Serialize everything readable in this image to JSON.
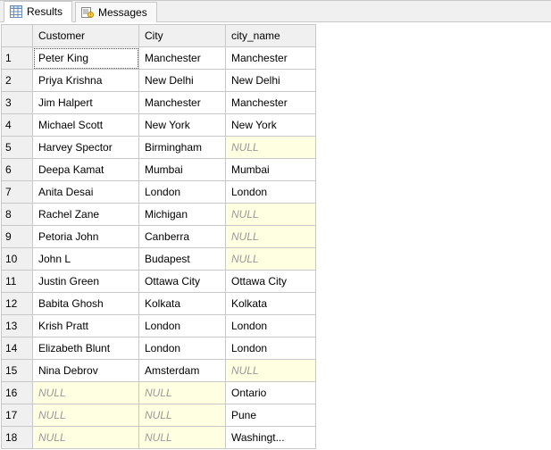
{
  "tabs": {
    "results": "Results",
    "messages": "Messages"
  },
  "columns": {
    "rownum": "",
    "customer": "Customer",
    "city": "City",
    "city_name": "city_name"
  },
  "null_text": "NULL",
  "rows": [
    {
      "n": "1",
      "customer": "Peter King",
      "city": "Manchester",
      "city_name": "Manchester",
      "cust_null": false,
      "city_null": false,
      "cn_null": false,
      "sel": true
    },
    {
      "n": "2",
      "customer": "Priya Krishna",
      "city": "New Delhi",
      "city_name": "New Delhi",
      "cust_null": false,
      "city_null": false,
      "cn_null": false,
      "sel": false
    },
    {
      "n": "3",
      "customer": "Jim Halpert",
      "city": "Manchester",
      "city_name": "Manchester",
      "cust_null": false,
      "city_null": false,
      "cn_null": false,
      "sel": false
    },
    {
      "n": "4",
      "customer": "Michael Scott",
      "city": "New York",
      "city_name": "New York",
      "cust_null": false,
      "city_null": false,
      "cn_null": false,
      "sel": false
    },
    {
      "n": "5",
      "customer": "Harvey Spector",
      "city": "Birmingham",
      "city_name": "NULL",
      "cust_null": false,
      "city_null": false,
      "cn_null": true,
      "sel": false
    },
    {
      "n": "6",
      "customer": "Deepa Kamat",
      "city": "Mumbai",
      "city_name": "Mumbai",
      "cust_null": false,
      "city_null": false,
      "cn_null": false,
      "sel": false
    },
    {
      "n": "7",
      "customer": "Anita Desai",
      "city": "London",
      "city_name": "London",
      "cust_null": false,
      "city_null": false,
      "cn_null": false,
      "sel": false
    },
    {
      "n": "8",
      "customer": "Rachel Zane",
      "city": "Michigan",
      "city_name": "NULL",
      "cust_null": false,
      "city_null": false,
      "cn_null": true,
      "sel": false
    },
    {
      "n": "9",
      "customer": "Petoria John",
      "city": "Canberra",
      "city_name": "NULL",
      "cust_null": false,
      "city_null": false,
      "cn_null": true,
      "sel": false
    },
    {
      "n": "10",
      "customer": "John L",
      "city": "Budapest",
      "city_name": "NULL",
      "cust_null": false,
      "city_null": false,
      "cn_null": true,
      "sel": false
    },
    {
      "n": "11",
      "customer": "Justin Green",
      "city": "Ottawa City",
      "city_name": "Ottawa City",
      "cust_null": false,
      "city_null": false,
      "cn_null": false,
      "sel": false
    },
    {
      "n": "12",
      "customer": "Babita Ghosh",
      "city": "Kolkata",
      "city_name": "Kolkata",
      "cust_null": false,
      "city_null": false,
      "cn_null": false,
      "sel": false
    },
    {
      "n": "13",
      "customer": "Krish Pratt",
      "city": "London",
      "city_name": "London",
      "cust_null": false,
      "city_null": false,
      "cn_null": false,
      "sel": false
    },
    {
      "n": "14",
      "customer": "Elizabeth Blunt",
      "city": "London",
      "city_name": "London",
      "cust_null": false,
      "city_null": false,
      "cn_null": false,
      "sel": false
    },
    {
      "n": "15",
      "customer": "Nina Debrov",
      "city": "Amsterdam",
      "city_name": "NULL",
      "cust_null": false,
      "city_null": false,
      "cn_null": true,
      "sel": false
    },
    {
      "n": "16",
      "customer": "NULL",
      "city": "NULL",
      "city_name": "Ontario",
      "cust_null": true,
      "city_null": true,
      "cn_null": false,
      "sel": false
    },
    {
      "n": "17",
      "customer": "NULL",
      "city": "NULL",
      "city_name": "Pune",
      "cust_null": true,
      "city_null": true,
      "cn_null": false,
      "sel": false
    },
    {
      "n": "18",
      "customer": "NULL",
      "city": "NULL",
      "city_name": "Washingt...",
      "cust_null": true,
      "city_null": true,
      "cn_null": false,
      "sel": false
    }
  ]
}
